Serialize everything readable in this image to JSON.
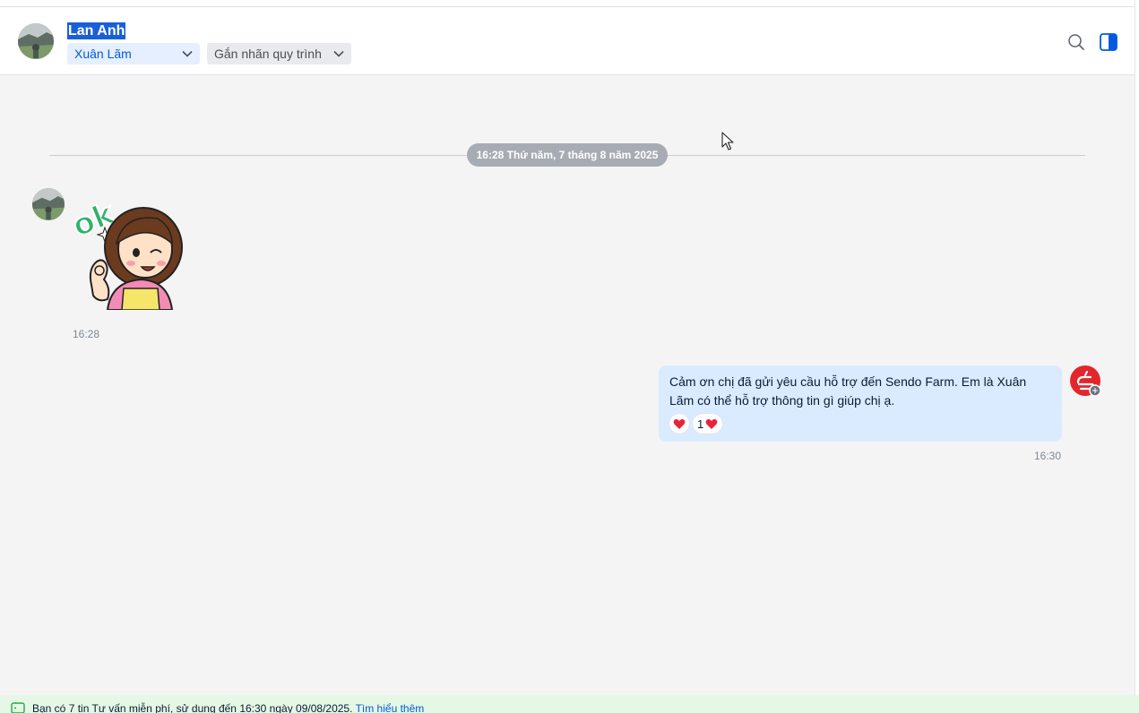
{
  "header": {
    "contact_name": "Lan Anh",
    "assignee": "Xuân Lãm",
    "tag_placeholder": "Gắn nhãn quy trình",
    "icons": {
      "search": "search-icon",
      "panel": "sidebar-toggle-icon"
    }
  },
  "conversation": {
    "date_separator": "16:28 Thứ năm, 7 tháng 8 năm 2025",
    "messages": [
      {
        "from": "contact",
        "type": "sticker",
        "sticker": "ok-girl-sticker",
        "sticker_text": "ok",
        "time": "16:28"
      },
      {
        "from": "me",
        "type": "text",
        "text": "Cảm ơn chị đã gửi yêu cầu hỗ trợ đến Sendo Farm. Em là Xuân Lãm có thể hỗ trợ thông tin gì giúp chị ạ.",
        "reaction_count": "1",
        "time": "16:30"
      }
    ]
  },
  "footer": {
    "notice": "Bạn có 7 tin Tư vấn miễn phí, sử dụng đến 16:30 ngày 09/08/2025.",
    "link": "Tìm hiểu thêm"
  },
  "colors": {
    "accent": "#005ae0",
    "bubble_out": "#dbebff",
    "chat_bg": "#f4f4f4",
    "footer_bg": "#e5f8e5",
    "heart": "#e8233a",
    "shop_brand": "#e3262c"
  }
}
